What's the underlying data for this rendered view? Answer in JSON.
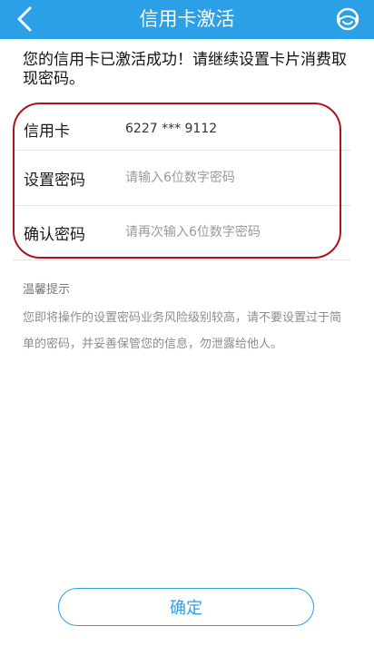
{
  "header": {
    "title": "信用卡激活",
    "back_icon": "chevron-left-icon",
    "service_icon": "customer-service-icon",
    "bg_color": "#2ba0e6"
  },
  "notice": "您的信用卡已激活成功！请继续设置卡片消费取现密码。",
  "form": {
    "card": {
      "label": "信用卡",
      "value": "6227 *** 9112"
    },
    "password": {
      "label": "设置密码",
      "placeholder": "请输入6位数字密码"
    },
    "confirm": {
      "label": "确认密码",
      "placeholder": "请再次输入6位数字密码"
    },
    "highlight_color": "#b0121b"
  },
  "tips": {
    "title": "温馨提示",
    "body": "您即将操作的设置密码业务风险级别较高，请不要设置过于简单的密码，并妥善保管您的信息，勿泄露给他人。"
  },
  "confirm_button": {
    "label": "确定"
  }
}
